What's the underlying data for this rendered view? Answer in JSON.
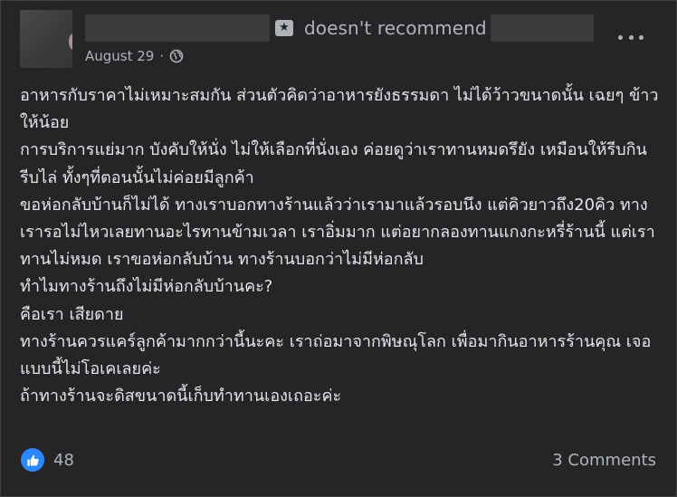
{
  "post": {
    "recommend_text": "doesn't recommend",
    "date": "August 29",
    "separator": "·",
    "body_lines": [
      "อาหารกับราคาไม่เหมาะสมกัน ส่วนตัวคิดว่าอาหารยังธรรมดา ไม่ได้ว้าวขนาดนั้น เฉยๆ ข้าวให้น้อย",
      "การบริการแย่มาก บังคับให้นั่ง ไม่ให้เลือกที่นั่งเอง ค่อยดูว่าเราทานหมดรึยัง เหมือนให้รีบกินรีบไล่ ทั้งๆที่ตอนนั้นไม่ค่อยมีลูกค้า",
      "ขอห่อกลับบ้านก็ไม่ได้ ทางเราบอกทางร้านแล้วว่าเรามาแล้วรอบนึง แต่คิวยาวถึง20คิว ทางเรารอไม่ไหวเลยทานอะไรทานข้ามเวลา เราอิ่มมาก แต่อยากลองทานแกงกะหรี่ร้านนี้ แต่เราทานไม่หมด เราขอห่อกลับบ้าน ทางร้านบอกว่าไม่มีห่อกลับ",
      "ทำไมทางร้านถึงไม่มีห่อกลับบ้านคะ?",
      "คือเรา เสียดาย",
      "ทางร้านควรแคร์ลูกค้ามากกว่านี้นะคะ เราถ่อมาจากพิษณุโลก เพื่อมากินอาหารร้านคุณ เจอแบบนี้ไม่โอเคเลยค่ะ",
      "ถ้าทางร้านจะดิสขนาดนี้เก็บทำทานเองเถอะค่ะ"
    ],
    "like_count": "48",
    "comments_label": "3 Comments"
  },
  "icons": {
    "badge": "recommendation-flag-icon",
    "privacy": "globe-icon",
    "more": "more-options-icon",
    "like": "like-icon"
  },
  "colors": {
    "card_background": "#242526",
    "primary_text": "#e4e6eb",
    "secondary_text": "#b0b3b8",
    "like_blue": "#2d88ff"
  }
}
